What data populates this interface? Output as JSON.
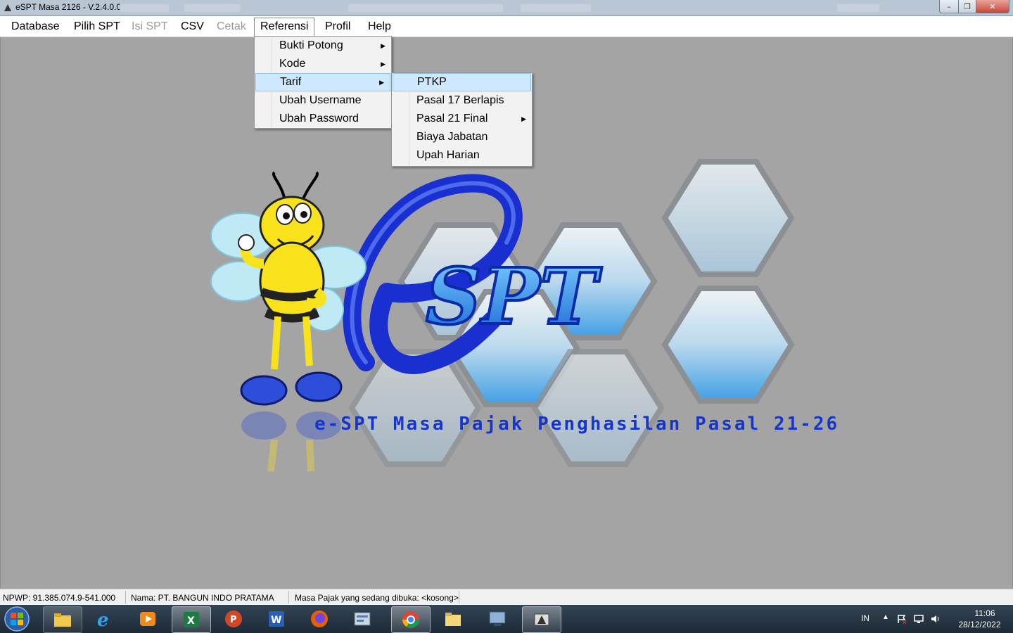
{
  "window": {
    "title": "eSPT Masa 2126 - V.2.4.0.0",
    "minimize_glyph": "–",
    "maximize_glyph": "❐",
    "close_glyph": "✕"
  },
  "menubar": {
    "items": [
      {
        "label": "Database",
        "enabled": true
      },
      {
        "label": "Pilih SPT",
        "enabled": true
      },
      {
        "label": "Isi SPT",
        "enabled": false
      },
      {
        "label": "CSV",
        "enabled": true
      },
      {
        "label": "Cetak",
        "enabled": false
      },
      {
        "label": "Referensi",
        "enabled": true,
        "open": true
      },
      {
        "label": "Profil",
        "enabled": true
      },
      {
        "label": "Help",
        "enabled": true
      }
    ]
  },
  "referensi_menu": {
    "items": [
      {
        "label": "Bukti Potong",
        "submenu": true
      },
      {
        "label": "Kode",
        "submenu": true
      },
      {
        "label": "Tarif",
        "submenu": true,
        "highlighted": true
      },
      {
        "label": "Ubah Username",
        "submenu": false
      },
      {
        "label": "Ubah Password",
        "submenu": false
      }
    ]
  },
  "tarif_menu": {
    "items": [
      {
        "label": "PTKP",
        "submenu": false,
        "highlighted": true
      },
      {
        "label": "Pasal 17 Berlapis",
        "submenu": false
      },
      {
        "label": "Pasal 21 Final",
        "submenu": true
      },
      {
        "label": "Biaya Jabatan",
        "submenu": false
      },
      {
        "label": "Upah Harian",
        "submenu": false
      }
    ]
  },
  "logo": {
    "wordmark": "SPT",
    "subtitle": "e-SPT Masa Pajak Penghasilan Pasal 21-26"
  },
  "statusbar": {
    "npwp": "NPWP: 91.385.074.9-541.000",
    "nama": "Nama: PT. BANGUN INDO PRATAMA",
    "masa": "Masa Pajak yang sedang dibuka: <kosong>"
  },
  "taskbar": {
    "apps": [
      "file-explorer",
      "internet-explorer",
      "media-player",
      "excel",
      "powerpoint",
      "word",
      "firefox",
      "control-panel",
      "chrome",
      "folder",
      "network",
      "espt"
    ],
    "language": "IN",
    "time": "11:06",
    "date": "28/12/2022"
  },
  "colors": {
    "accent_blue": "#1636c9",
    "menu_highlight": "#cde8ff",
    "client_bg": "#a4a4a4"
  }
}
